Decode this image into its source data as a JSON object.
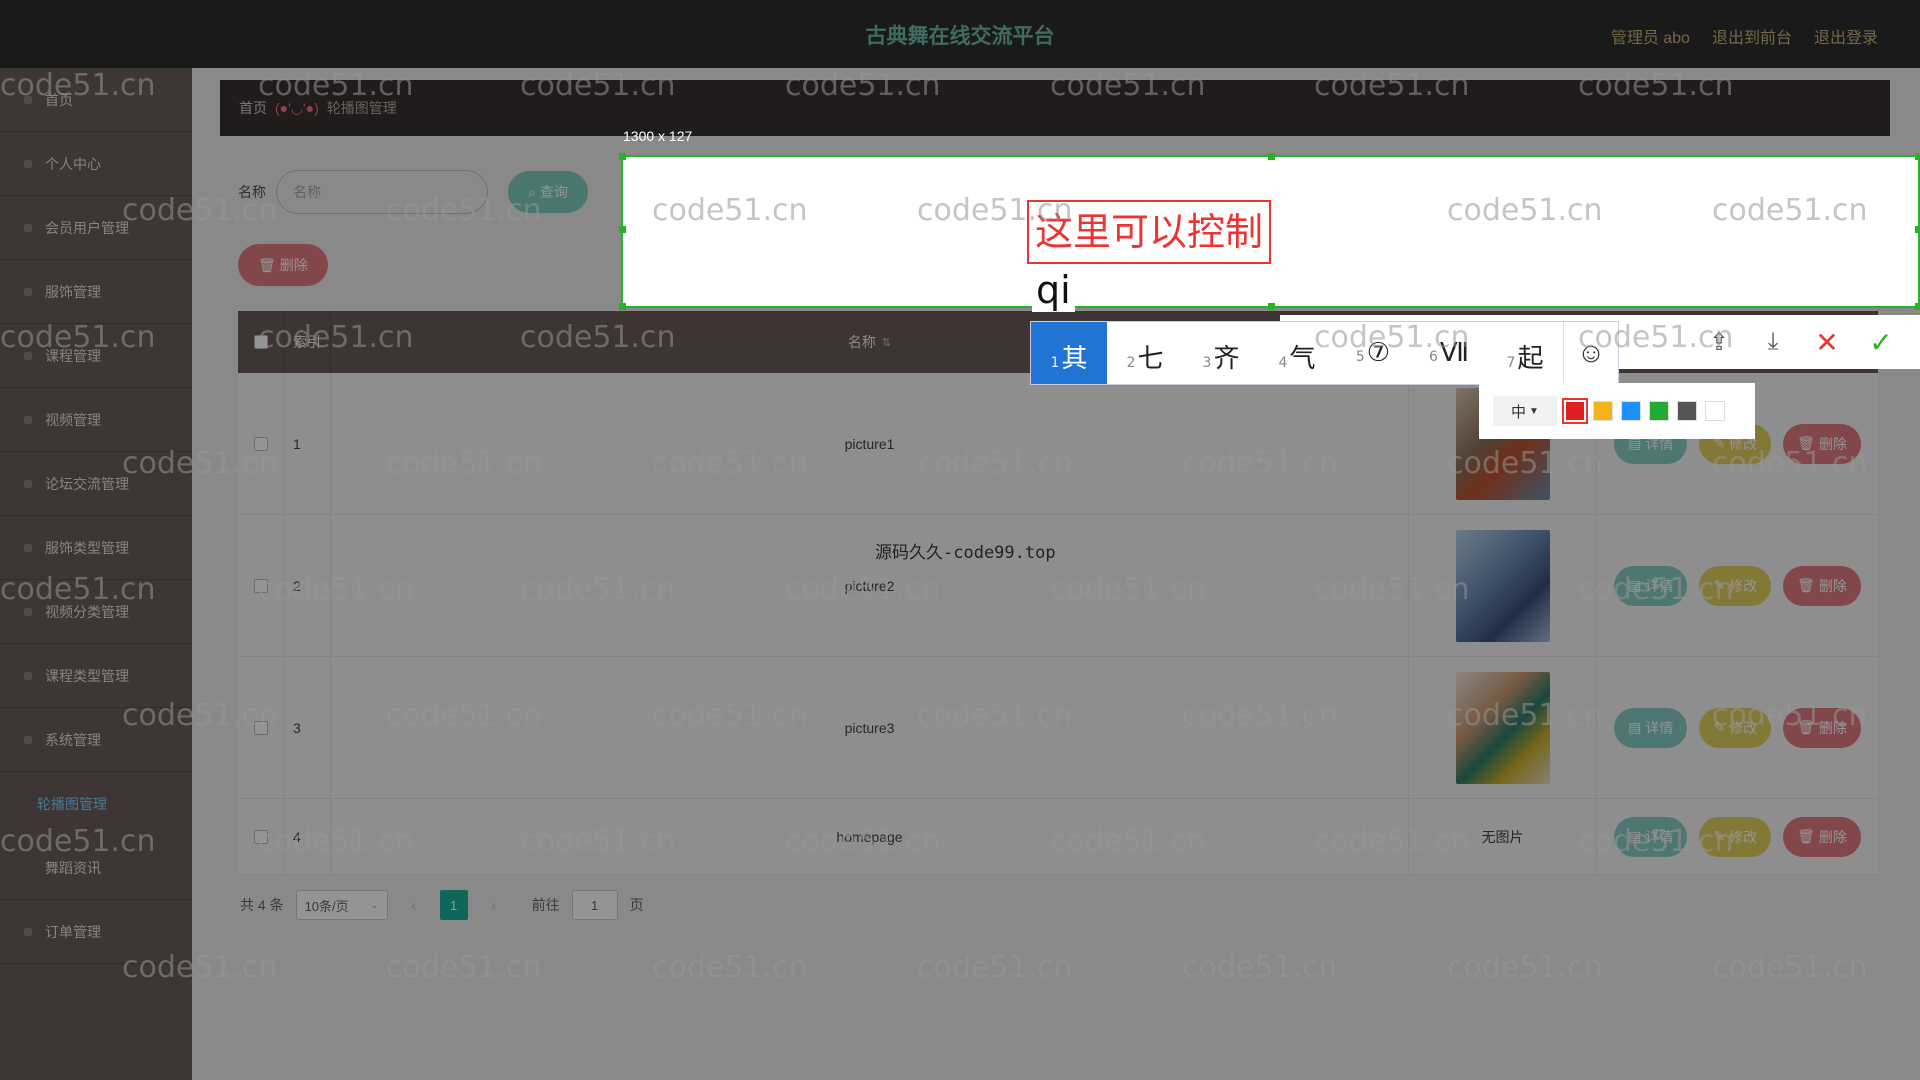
{
  "header": {
    "title": "古典舞在线交流平台",
    "links": [
      "管理员 abo",
      "退出到前台",
      "退出登录"
    ]
  },
  "sidebar": {
    "items": [
      {
        "label": "首页"
      },
      {
        "label": "个人中心"
      },
      {
        "label": "会员用户管理"
      },
      {
        "label": "服饰管理"
      },
      {
        "label": "课程管理"
      },
      {
        "label": "视频管理"
      },
      {
        "label": "论坛交流管理"
      },
      {
        "label": "服饰类型管理"
      },
      {
        "label": "视频分类管理"
      },
      {
        "label": "课程类型管理"
      },
      {
        "label": "系统管理"
      },
      {
        "label": "轮播图管理"
      },
      {
        "label": "舞蹈资讯"
      },
      {
        "label": "订单管理"
      }
    ]
  },
  "breadcrumb": {
    "home": "首页",
    "face": "(●'◡'●)",
    "current": "轮播图管理"
  },
  "search": {
    "label": "名称",
    "placeholder": "名称",
    "query_button": "查询",
    "delete_button": "删除"
  },
  "table": {
    "columns": [
      "索引",
      "名称"
    ],
    "rows": [
      {
        "index": "1",
        "name": "picture1",
        "image": "thumb-1"
      },
      {
        "index": "2",
        "name": "picture2",
        "image": "thumb-2"
      },
      {
        "index": "3",
        "name": "picture3",
        "image": "thumb-3"
      },
      {
        "index": "4",
        "name": "homepage",
        "image_text": "无图片"
      }
    ],
    "ops": {
      "detail": "详情",
      "edit": "修改",
      "delete": "删除"
    }
  },
  "pagination": {
    "total": "共 4 条",
    "page_size": "10条/页",
    "current_page": "1",
    "goto_prefix": "前往",
    "goto_value": "1",
    "goto_suffix": "页"
  },
  "screenshot_tool": {
    "size_label": "1300 x 127",
    "annotation_text": "这里可以控制",
    "ime_composition": "qi",
    "candidates": [
      {
        "n": "1",
        "c": "其"
      },
      {
        "n": "2",
        "c": "七"
      },
      {
        "n": "3",
        "c": "齐"
      },
      {
        "n": "4",
        "c": "气"
      },
      {
        "n": "5",
        "c": "⑦"
      },
      {
        "n": "6",
        "c": "Ⅶ"
      },
      {
        "n": "7",
        "c": "起"
      }
    ],
    "font_size": "中",
    "colors": [
      "#e02020",
      "#f5b31b",
      "#1e90ff",
      "#22aa33",
      "#555555",
      "#ffffff"
    ],
    "selected_color": "#e02020"
  },
  "watermark": "code51.cn",
  "source_text": "源码久久-code99.top"
}
